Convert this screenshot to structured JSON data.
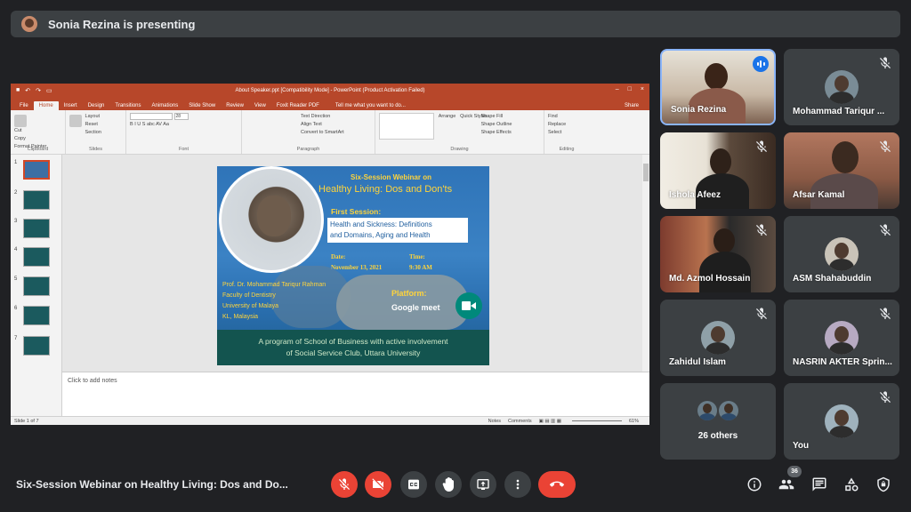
{
  "presenting": {
    "text": "Sonia Rezina is presenting"
  },
  "powerpoint": {
    "window_title": "About Speaker.ppt [Compatibility Mode] - PowerPoint (Product Activation Failed)",
    "tabs": [
      "File",
      "Home",
      "Insert",
      "Design",
      "Transitions",
      "Animations",
      "Slide Show",
      "Review",
      "View",
      "Foxit Reader PDF"
    ],
    "active_tab": "Home",
    "tell_me": "Tell me what you want to do...",
    "share": "Share",
    "ribbon": {
      "clipboard": {
        "paste": "Paste",
        "cut": "Cut",
        "copy": "Copy",
        "format_painter": "Format Painter",
        "label": "Clipboard"
      },
      "slides": {
        "new_slide": "New Slide",
        "layout": "Layout",
        "reset": "Reset",
        "section": "Section",
        "label": "Slides"
      },
      "font": {
        "size": "28",
        "format": "B I U S abc AV Aa",
        "label": "Font"
      },
      "paragraph": {
        "text_direction": "Text Direction",
        "align_text": "Align Text",
        "convert_smartart": "Convert to SmartArt",
        "label": "Paragraph"
      },
      "drawing": {
        "arrange": "Arrange",
        "quick_styles": "Quick Styles",
        "shape_fill": "Shape Fill",
        "shape_outline": "Shape Outline",
        "shape_effects": "Shape Effects",
        "label": "Drawing"
      },
      "editing": {
        "find": "Find",
        "replace": "Replace",
        "select": "Select",
        "label": "Editing"
      }
    },
    "slide_numbers": [
      "1",
      "2",
      "3",
      "4",
      "5",
      "6",
      "7"
    ],
    "notes_placeholder": "Click to add notes",
    "status": {
      "slide": "Slide 1 of 7",
      "notes": "Notes",
      "comments": "Comments",
      "zoom": "61%"
    }
  },
  "slide": {
    "kicker": "Six-Session Webinar on",
    "title": "Healthy Living: Dos and Don'ts",
    "session": "First Session:",
    "topic_line1": "Health and Sickness: Definitions",
    "topic_line2": "and Domains, Aging and Health",
    "date_label": "Date:",
    "date_value": "November 13, 2021",
    "time_label": "Time:",
    "time_value": "9:30 AM",
    "speaker_lines": [
      "Prof. Dr. Mohammad Tariqur Rahman",
      "Faculty of Dentistry",
      "University of Malaya",
      "KL, Malaysia"
    ],
    "platform_label": "Platform:",
    "platform_value": "Google meet",
    "footer_line1": "A program of School of Business with active involvement",
    "footer_line2": "of Social Service Club, Uttara University"
  },
  "participants": [
    {
      "name": "Sonia Rezina"
    },
    {
      "name": "Mohammad Tariqur ..."
    },
    {
      "name": "Ishola Afeez"
    },
    {
      "name": "Afsar Kamal"
    },
    {
      "name": "Md. Azmol Hossain"
    },
    {
      "name": "ASM Shahabuddin"
    },
    {
      "name": "Zahidul Islam"
    },
    {
      "name": "NASRIN AKTER Sprin..."
    },
    {
      "name": "26 others"
    },
    {
      "name": "You"
    }
  ],
  "meeting": {
    "title": "Six-Session Webinar on Healthy Living: Dos and Do...",
    "people_count": "36"
  },
  "colors": {
    "background": "#202124",
    "tile": "#3c4043",
    "danger": "#ea4335",
    "accent": "#1a73e8",
    "ppt_red": "#b7472a"
  }
}
